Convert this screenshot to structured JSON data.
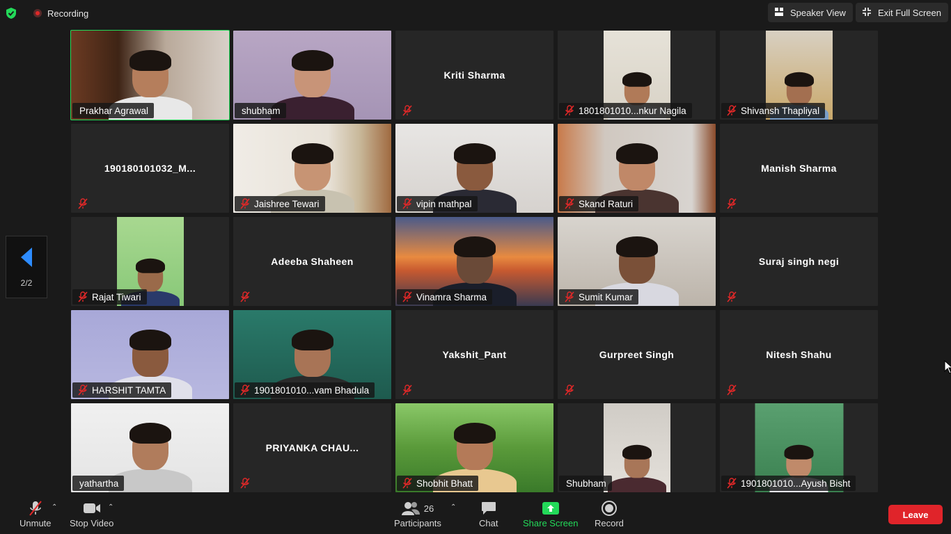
{
  "header": {
    "recording_label": "Recording",
    "speaker_view_label": "Speaker View",
    "exit_full_screen_label": "Exit Full Screen"
  },
  "pager": {
    "page_indicator": "2/2"
  },
  "participants": [
    {
      "name": "Prakhar Agrawal",
      "video": true,
      "muted": false,
      "active_speaker": true
    },
    {
      "name": "shubham",
      "video": true,
      "muted": false
    },
    {
      "name": "Kriti Sharma",
      "video": false,
      "muted": true
    },
    {
      "name": "1801801010...nkur Nagila",
      "video": true,
      "muted": true
    },
    {
      "name": "Shivansh Thapliyal",
      "video": true,
      "muted": true
    },
    {
      "name": "190180101032_M...",
      "video": false,
      "muted": true
    },
    {
      "name": "Jaishree Tewari",
      "video": true,
      "muted": true
    },
    {
      "name": "vipin mathpal",
      "video": true,
      "muted": true
    },
    {
      "name": "Skand Raturi",
      "video": true,
      "muted": true
    },
    {
      "name": "Manish Sharma",
      "video": false,
      "muted": true
    },
    {
      "name": "Rajat Tiwari",
      "video": true,
      "muted": true
    },
    {
      "name": "Adeeba Shaheen",
      "video": false,
      "muted": true
    },
    {
      "name": "Vinamra Sharma",
      "video": true,
      "muted": true
    },
    {
      "name": "Sumit Kumar",
      "video": true,
      "muted": true
    },
    {
      "name": "Suraj singh negi",
      "video": false,
      "muted": true
    },
    {
      "name": "HARSHIT TAMTA",
      "video": true,
      "muted": true
    },
    {
      "name": "1901801010...vam Bhadula",
      "video": true,
      "muted": true
    },
    {
      "name": "Yakshit_Pant",
      "video": false,
      "muted": true
    },
    {
      "name": "Gurpreet Singh",
      "video": false,
      "muted": true
    },
    {
      "name": "Nitesh Shahu",
      "video": false,
      "muted": true
    },
    {
      "name": "yathartha",
      "video": true,
      "muted": false
    },
    {
      "name": "PRIYANKA CHAU...",
      "video": false,
      "muted": true
    },
    {
      "name": "Shobhit Bhatt",
      "video": true,
      "muted": true
    },
    {
      "name": "Shubham",
      "video": true,
      "muted": false
    },
    {
      "name": "1901801010...Ayush Bisht",
      "video": true,
      "muted": true
    }
  ],
  "toolbar": {
    "unmute_label": "Unmute",
    "stop_video_label": "Stop Video",
    "participants_label": "Participants",
    "participants_count": "26",
    "chat_label": "Chat",
    "share_screen_label": "Share Screen",
    "record_label": "Record",
    "leave_label": "Leave"
  },
  "colors": {
    "background": "#1a1a1a",
    "tile": "#262626",
    "active_border": "#23d959",
    "share_green": "#23d959",
    "leave_red": "#e0242a",
    "muted_red": "#e02828",
    "pager_arrow": "#2d8cff"
  }
}
